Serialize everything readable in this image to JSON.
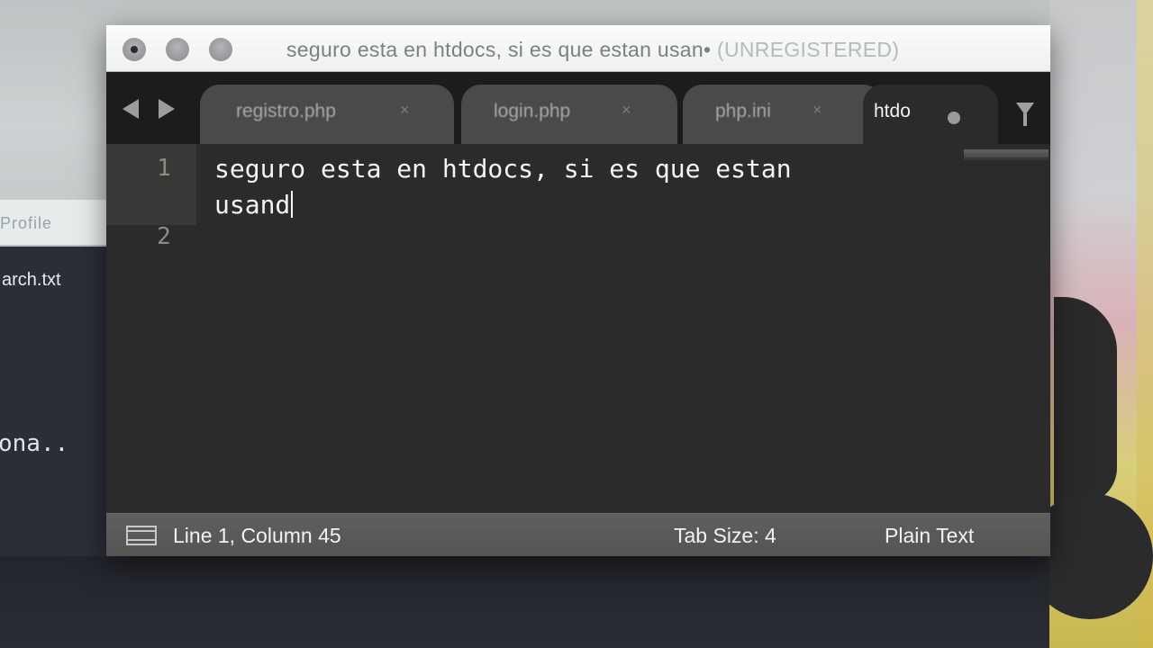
{
  "background": {
    "back_window_header": "Profile",
    "back_window_file": "arch.txt",
    "back_terminal_text": "ona.."
  },
  "window": {
    "title": "seguro esta en htdocs, si es que estan usan•",
    "title_suffix": "(UNREGISTERED)",
    "traffic_lights": [
      "close",
      "minimize",
      "maximize"
    ],
    "close_dirty": true
  },
  "tabs": [
    {
      "label": "registro.php",
      "close": "×",
      "active": false
    },
    {
      "label": "login.php",
      "close": "×",
      "active": false
    },
    {
      "label": "php.ini",
      "close": "×",
      "active": false
    },
    {
      "label": "htdo",
      "active": true,
      "dirty": true
    }
  ],
  "nav": {
    "prev_icon": "triangle-left",
    "next_icon": "triangle-right",
    "tab_menu_icon": "triangle-down"
  },
  "editor": {
    "line_numbers": [
      "1",
      "2"
    ],
    "lines": [
      "seguro esta en htdocs, si es que estan usand",
      ""
    ]
  },
  "status": {
    "panel_icon": "panel-toggle",
    "position": "Line 1, Column 45",
    "tab_size": "Tab Size: 4",
    "syntax": "Plain Text"
  }
}
